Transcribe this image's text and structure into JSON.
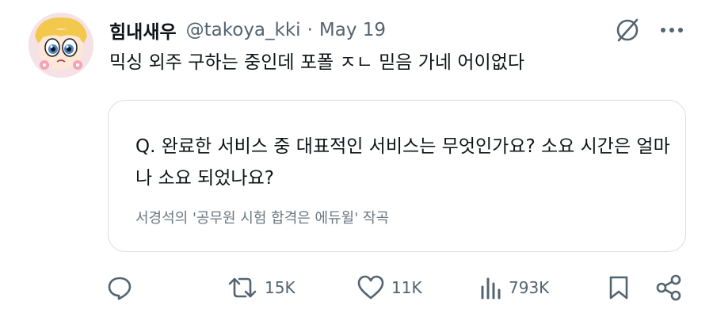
{
  "tweet": {
    "display_name": "힘내새우",
    "handle": "@takoya_kki",
    "separator": "·",
    "date": "May 19",
    "text": "믹싱 외주 구하는 중인데 포폴 ㅈㄴ 믿음 가네 어이없다"
  },
  "card": {
    "question": "Q. 완료한 서비스 중 대표적인 서비스는 무엇인가요? 소요 시간은 얼마나 소요 되었나요?",
    "source": "서경석의 '공무원 시험 합격은 에듀윌' 작곡"
  },
  "actions": {
    "reply_icon": "reply-icon",
    "retweet_icon": "retweet-icon",
    "retweet_count": "15K",
    "like_icon": "heart-icon",
    "like_count": "11K",
    "views_icon": "views-chart-icon",
    "views_count": "793K",
    "bookmark_icon": "bookmark-icon",
    "share_icon": "share-icon"
  },
  "colors": {
    "text_primary": "#0f1419",
    "text_secondary": "#536471",
    "card_border": "#d9dee2"
  }
}
